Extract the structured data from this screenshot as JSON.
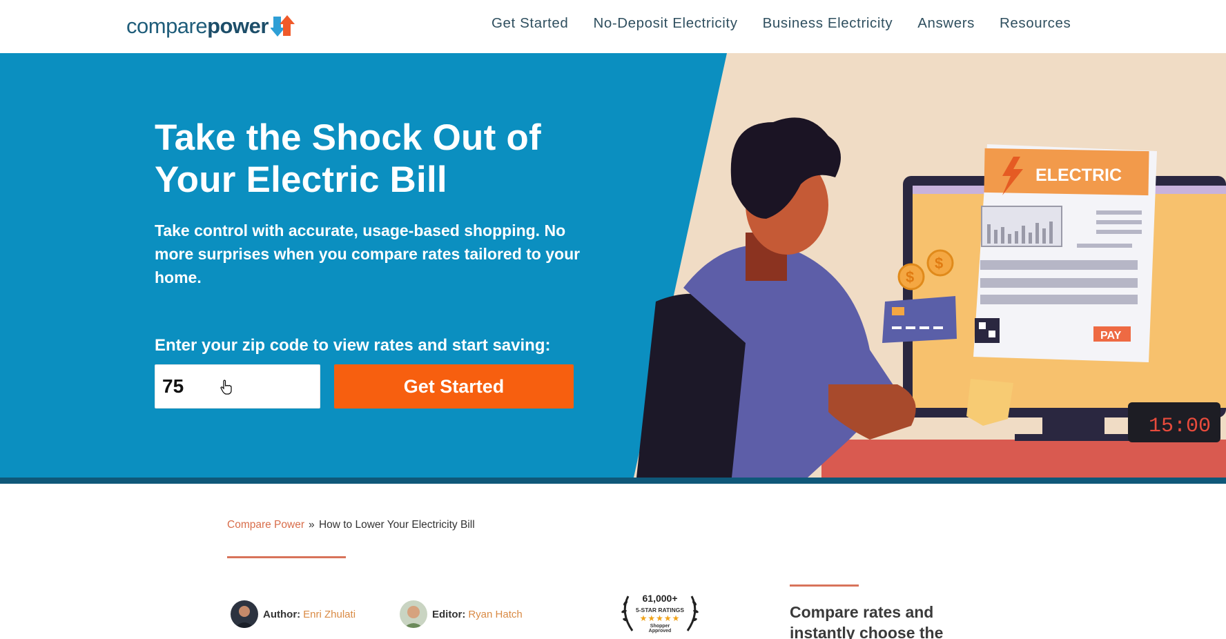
{
  "header": {
    "logo": {
      "text_light": "compare",
      "text_bold": "power"
    },
    "nav": [
      {
        "label": "Get Started"
      },
      {
        "label": "No-Deposit Electricity"
      },
      {
        "label": "Business Electricity"
      },
      {
        "label": "Answers"
      },
      {
        "label": "Resources"
      }
    ]
  },
  "hero": {
    "title": "Take the Shock Out of Your Electric Bill",
    "subtitle": "Take control with accurate, usage-based shopping. No more surprises when you compare rates tailored to your home.",
    "zip_label": "Enter your zip code to view rates and start saving:",
    "zip_value": "75",
    "cta_label": "Get Started",
    "illustration": {
      "bill_label": "ELECTRIC",
      "pay_label": "PAY",
      "clock_time": "15:00"
    }
  },
  "breadcrumb": {
    "home": "Compare Power",
    "separator": "»",
    "current": "How to Lower Your Electricity Bill"
  },
  "authors": {
    "author_role": "Author:",
    "author_name": "Enri Zhulati",
    "editor_role": "Editor:",
    "editor_name": "Ryan Hatch"
  },
  "badge": {
    "count": "61,000+",
    "ratings": "5-STAR RATINGS",
    "stars": "★★★★★",
    "brand_line1": "Shopper",
    "brand_line2": "Approved"
  },
  "sidebar": {
    "heading": "Compare rates and instantly choose the"
  },
  "colors": {
    "hero_blue": "#0b8fc0",
    "cta_orange": "#f75f0f",
    "accent": "#d8735a",
    "link": "#d98a44"
  }
}
